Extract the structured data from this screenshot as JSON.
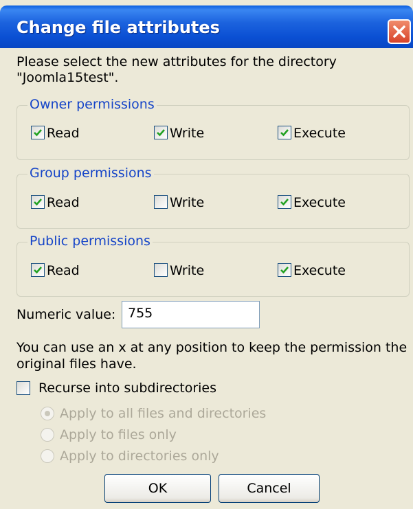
{
  "dialog": {
    "title": "Change file attributes",
    "prompt_line1": "Please select the new attributes for the directory",
    "prompt_line2": "\"Joomla15test\"."
  },
  "groups": [
    {
      "legend": "Owner permissions",
      "read": {
        "label": "Read",
        "checked": true
      },
      "write": {
        "label": "Write",
        "checked": true
      },
      "execute": {
        "label": "Execute",
        "checked": true
      }
    },
    {
      "legend": "Group permissions",
      "read": {
        "label": "Read",
        "checked": true
      },
      "write": {
        "label": "Write",
        "checked": false
      },
      "execute": {
        "label": "Execute",
        "checked": true
      }
    },
    {
      "legend": "Public permissions",
      "read": {
        "label": "Read",
        "checked": true
      },
      "write": {
        "label": "Write",
        "checked": false
      },
      "execute": {
        "label": "Execute",
        "checked": true
      }
    }
  ],
  "numeric": {
    "label": "Numeric value:",
    "value": "755"
  },
  "hint_line1": "You can use an x at any position to keep the permission the",
  "hint_line2": "original files have.",
  "recurse": {
    "label": "Recurse into subdirectories",
    "checked": false
  },
  "apply_options": [
    {
      "label": "Apply to all files and directories",
      "selected": true,
      "enabled": false
    },
    {
      "label": "Apply to files only",
      "selected": false,
      "enabled": false
    },
    {
      "label": "Apply to directories only",
      "selected": false,
      "enabled": false
    }
  ],
  "buttons": {
    "ok": "OK",
    "cancel": "Cancel"
  },
  "colors": {
    "title_bar": "#0a4fd3",
    "dialog_bg": "#ece9d8",
    "legend_text": "#1645c8",
    "check_green": "#21a121",
    "close_red": "#d8432a"
  }
}
